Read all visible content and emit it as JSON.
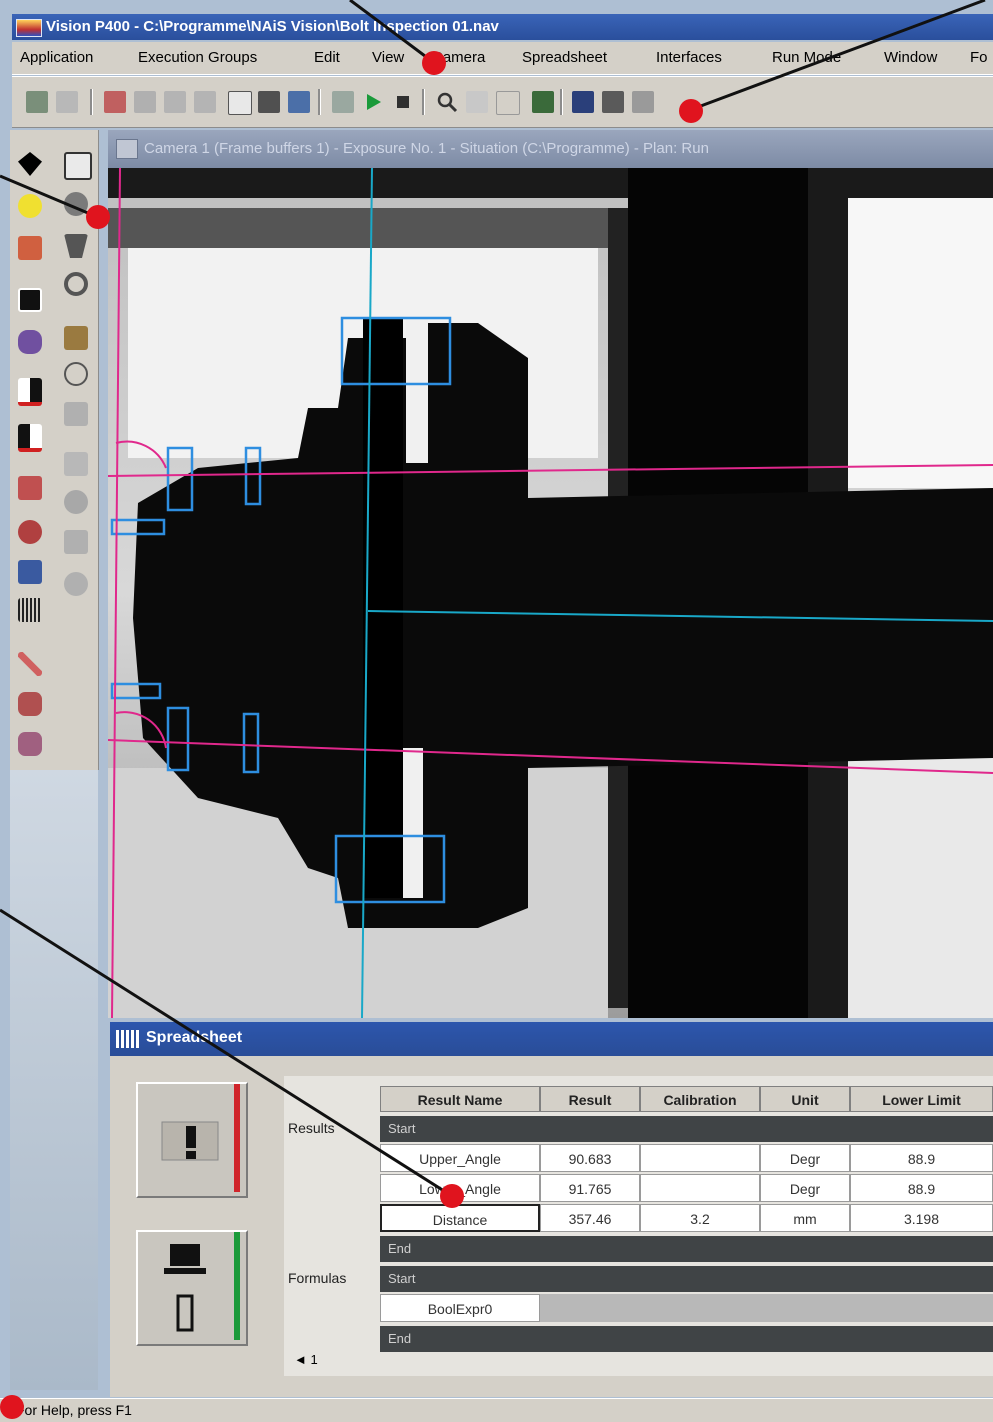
{
  "window": {
    "title": "Vision P400 - C:\\Programme\\NAiS Vision\\Bolt Inspection 01.nav"
  },
  "menu": [
    {
      "label": "Application"
    },
    {
      "label": "Execution Groups"
    },
    {
      "label": "Edit"
    },
    {
      "label": "View"
    },
    {
      "label": "Camera"
    },
    {
      "label": "Spreadsheet"
    },
    {
      "label": "Interfaces"
    },
    {
      "label": "Run Mode"
    },
    {
      "label": "Window"
    },
    {
      "label": "Fo"
    }
  ],
  "image_window": {
    "caption": "Camera 1 (Frame buffers 1) - Exposure No. 1 - Situation (C:\\Programme) - Plan: Run"
  },
  "spreadsheet": {
    "title": "Spreadsheet",
    "columns": [
      "Result Name",
      "Result",
      "Calibration",
      "Unit",
      "Lower Limit"
    ],
    "results_label": "Results",
    "formulas_label": "Formulas",
    "start_label": "Start",
    "end_label": "End",
    "rows": [
      {
        "name": "Upper_Angle",
        "result": "90.683",
        "calibration": "",
        "unit": "Degr",
        "lower": "88.9"
      },
      {
        "name": "Lower_Angle",
        "result": "91.765",
        "calibration": "",
        "unit": "Degr",
        "lower": "88.9"
      },
      {
        "name": "Distance",
        "result": "357.46",
        "calibration": "3.2",
        "unit": "mm",
        "lower": "3.198"
      }
    ],
    "formula_rows": [
      {
        "name": "BoolExpr0"
      }
    ],
    "scroll_indicator": "◄ 1"
  },
  "status": {
    "text": "For Help, press F1"
  },
  "colors": {
    "accent": "#2a4f9c",
    "callout": "#e0141e",
    "overlay_magenta": "#e0288c",
    "overlay_cyan": "#19a8c8",
    "overlay_blue": "#2e8ee0"
  },
  "icons": [
    "shield-icon",
    "rectangle-tool-icon",
    "circle-tool-icon",
    "trapezoid-tool-icon",
    "ring-tool-icon",
    "play-icon",
    "stop-icon",
    "zoom-icon",
    "camera-icon",
    "layout-icon"
  ]
}
